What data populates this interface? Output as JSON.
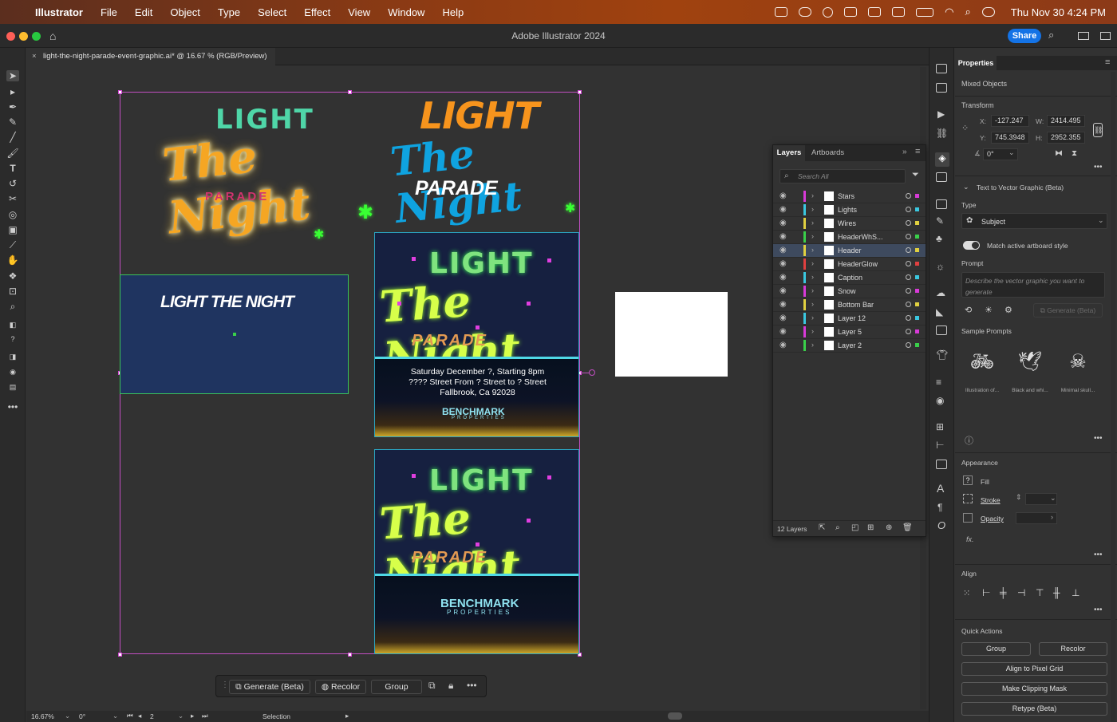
{
  "menubar": {
    "app_name": "Illustrator",
    "items": [
      "File",
      "Edit",
      "Object",
      "Type",
      "Select",
      "Effect",
      "View",
      "Window",
      "Help"
    ],
    "clock": "Thu Nov 30  4:24 PM"
  },
  "window": {
    "title": "Adobe Illustrator 2024",
    "share_label": "Share"
  },
  "document": {
    "tab_label": "light-the-night-parade-event-graphic.ai* @ 16.67 % (RGB/Preview)"
  },
  "artwork": {
    "logo1": {
      "light": "LIGHT",
      "script": "The Night",
      "parade": "PARADE"
    },
    "logo2": {
      "light": "LIGHT",
      "script": "The Night",
      "parade": "PARADE"
    },
    "banner_text": "LIGHT THE NIGHT",
    "poster1": {
      "light": "LIGHT",
      "script": "The Night",
      "parade": "PARADE",
      "line1": "Saturday December ?, Starting 8pm",
      "line2": "???? Street From ? Street to ? Street",
      "line3": "Fallbrook, Ca 92028",
      "brand": "BENCHMARK",
      "brand_sub": "PROPERTIES"
    },
    "poster2": {
      "light": "LIGHT",
      "script": "The Night",
      "parade": "PARADE",
      "brand": "BENCHMARK",
      "brand_sub": "PROPERTIES"
    }
  },
  "context_bar": {
    "generate": "Generate (Beta)",
    "recolor": "Recolor",
    "group": "Group"
  },
  "status_bar": {
    "zoom": "16.67%",
    "rotation": "0°",
    "artboard": "2",
    "tool": "Selection"
  },
  "layers_panel": {
    "tabs": [
      "Layers",
      "Artboards"
    ],
    "search_placeholder": "Search All",
    "count_label": "12 Layers",
    "layers": [
      {
        "name": "Stars",
        "color": "#d83ad8"
      },
      {
        "name": "Lights",
        "color": "#3ac8e0"
      },
      {
        "name": "Wires",
        "color": "#e0d040"
      },
      {
        "name": "HeaderWhS...",
        "color": "#3ad04a"
      },
      {
        "name": "Header",
        "color": "#e0d040"
      },
      {
        "name": "HeaderGlow",
        "color": "#e04040"
      },
      {
        "name": "Caption",
        "color": "#3ac8e0"
      },
      {
        "name": "Snow",
        "color": "#d83ad8"
      },
      {
        "name": "Bottom Bar",
        "color": "#e0d040"
      },
      {
        "name": "Layer 12",
        "color": "#3ac8e0"
      },
      {
        "name": "Layer 5",
        "color": "#d83ad8"
      },
      {
        "name": "Layer 2",
        "color": "#3ad04a"
      }
    ]
  },
  "properties": {
    "tab": "Properties",
    "selection_type": "Mixed Objects",
    "transform_title": "Transform",
    "x_label": "X:",
    "x": "-127.247",
    "y_label": "Y:",
    "y": "745.3948",
    "w_label": "W:",
    "w": "2414.495",
    "h_label": "H:",
    "h": "2952.355",
    "angle": "0°",
    "t2v_title": "Text to Vector Graphic (Beta)",
    "type_label": "Type",
    "type_value": "Subject",
    "match_label": "Match active artboard style",
    "prompt_label": "Prompt",
    "prompt_placeholder": "Describe the vector graphic you want to generate",
    "generate_btn": "Generate (Beta)",
    "sample_title": "Sample Prompts",
    "samples": [
      "Illustration of...",
      "Black and whi...",
      "Minimal skull..."
    ],
    "appearance_title": "Appearance",
    "fill_label": "Fill",
    "stroke_label": "Stroke",
    "opacity_label": "Opacity",
    "fx_label": "fx.",
    "align_title": "Align",
    "quick_title": "Quick Actions",
    "qa_group": "Group",
    "qa_recolor": "Recolor",
    "qa_pixel": "Align to Pixel Grid",
    "qa_clip": "Make Clipping Mask",
    "qa_retype": "Retype (Beta)"
  }
}
